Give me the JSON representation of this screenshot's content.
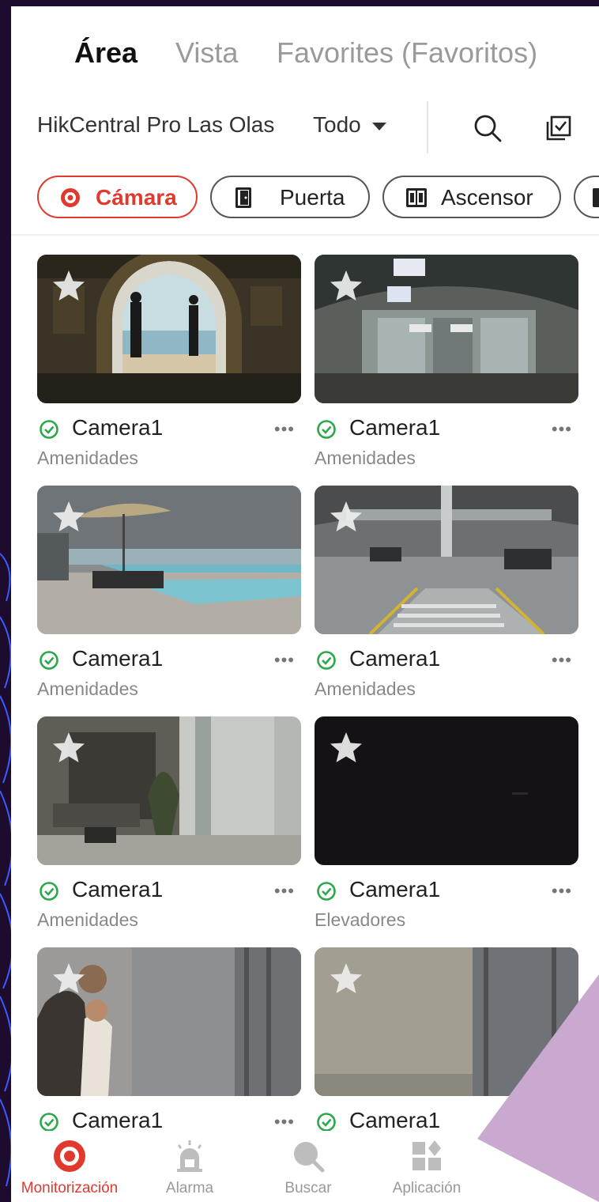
{
  "tabs": [
    {
      "label": "Área",
      "active": true
    },
    {
      "label": "Vista",
      "active": false
    },
    {
      "label": "Favorites (Favoritos)",
      "active": false
    }
  ],
  "filter": {
    "site": "HikCentral Pro Las Olas",
    "scope": "Todo",
    "icons": [
      "search-icon",
      "select-all-icon"
    ]
  },
  "chips": [
    {
      "label": "Cámara",
      "icon": "camera-target-icon",
      "active": true
    },
    {
      "label": "Puerta",
      "icon": "door-icon",
      "active": false
    },
    {
      "label": "Ascensor",
      "icon": "elevator-icon",
      "active": false
    }
  ],
  "cameras": [
    {
      "name": "Camera1",
      "area": "Amenidades",
      "status": "online",
      "scene": "archway-beach"
    },
    {
      "name": "Camera1",
      "area": "Amenidades",
      "status": "online",
      "scene": "lobby-glass"
    },
    {
      "name": "Camera1",
      "area": "Amenidades",
      "status": "online",
      "scene": "pool-umbrella"
    },
    {
      "name": "Camera1",
      "area": "Amenidades",
      "status": "online",
      "scene": "parking"
    },
    {
      "name": "Camera1",
      "area": "Amenidades",
      "status": "online",
      "scene": "lounge"
    },
    {
      "name": "Camera1",
      "area": "Elevadores",
      "status": "online",
      "scene": "dark"
    },
    {
      "name": "Camera1",
      "area": "",
      "status": "online",
      "scene": "elevator-people"
    },
    {
      "name": "Camera1",
      "area": "",
      "status": "online",
      "scene": "elevator-empty"
    }
  ],
  "more_label": "•••",
  "bottom_nav": [
    {
      "label": "Monitorización",
      "icon": "monitor-target-icon",
      "active": true
    },
    {
      "label": "Alarma",
      "icon": "alarm-siren-icon",
      "active": false
    },
    {
      "label": "Buscar",
      "icon": "search-icon",
      "active": false
    },
    {
      "label": "Aplicación",
      "icon": "apps-grid-icon",
      "active": false
    }
  ],
  "colors": {
    "accent": "#e03a2f",
    "online": "#2aa84a",
    "frame_bg": "#1e0c2e",
    "deco_line": "#3b5bff",
    "deco_triangle": "#c9a9cf"
  }
}
